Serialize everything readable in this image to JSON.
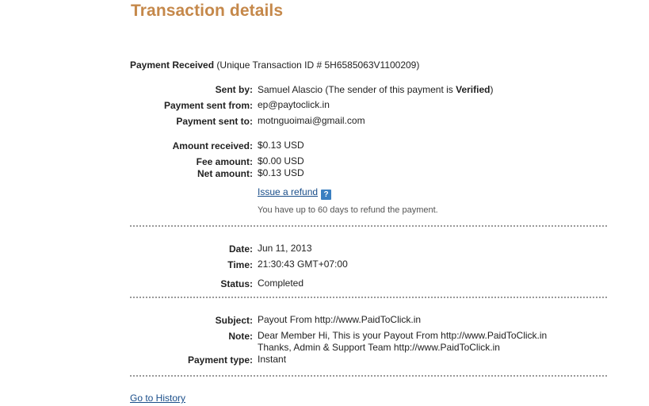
{
  "header": {
    "title": "Transaction details"
  },
  "summary": {
    "label": "Payment Received",
    "transaction_id_text": "(Unique Transaction ID # 5H6585063V1100209)"
  },
  "sender": {
    "sent_by_label": "Sent by:",
    "sent_by_value": "Samuel Alascio (The sender of this payment is ",
    "verified": "Verified",
    "close_paren": ")",
    "sent_from_label": "Payment sent from:",
    "sent_from_value": "ep@paytoclick.in",
    "sent_to_label": "Payment sent to:",
    "sent_to_value": "motnguoimai@gmail.com"
  },
  "amounts": {
    "received_label": "Amount received:",
    "received_value": "$0.13 USD",
    "fee_label": "Fee amount:",
    "fee_value": "$0.00 USD",
    "net_label": "Net amount:",
    "net_value": "$0.13 USD",
    "refund_link": "Issue a refund",
    "help_icon": "?",
    "refund_hint": "You have up to 60 days to refund the payment."
  },
  "timing": {
    "date_label": "Date:",
    "date_value": "Jun 11, 2013",
    "time_label": "Time:",
    "time_value": "21:30:43 GMT+07:00",
    "status_label": "Status:",
    "status_value": "Completed"
  },
  "message": {
    "subject_label": "Subject:",
    "subject_value": "Payout From http://www.PaidToClick.in",
    "note_label": "Note:",
    "note_line1": "Dear Member Hi, This is your Payout From http://www.PaidToClick.in",
    "note_line2": "Thanks, Admin & Support Team http://www.PaidToClick.in",
    "type_label": "Payment type:",
    "type_value": "Instant"
  },
  "footer": {
    "history_link": "Go to History"
  },
  "colors": {
    "title": "#c5884a",
    "link": "#1a4e8a",
    "help_icon_bg": "#3a7fc1",
    "divider": "#9a9a9a"
  },
  "icons": {
    "help": "help-icon"
  }
}
